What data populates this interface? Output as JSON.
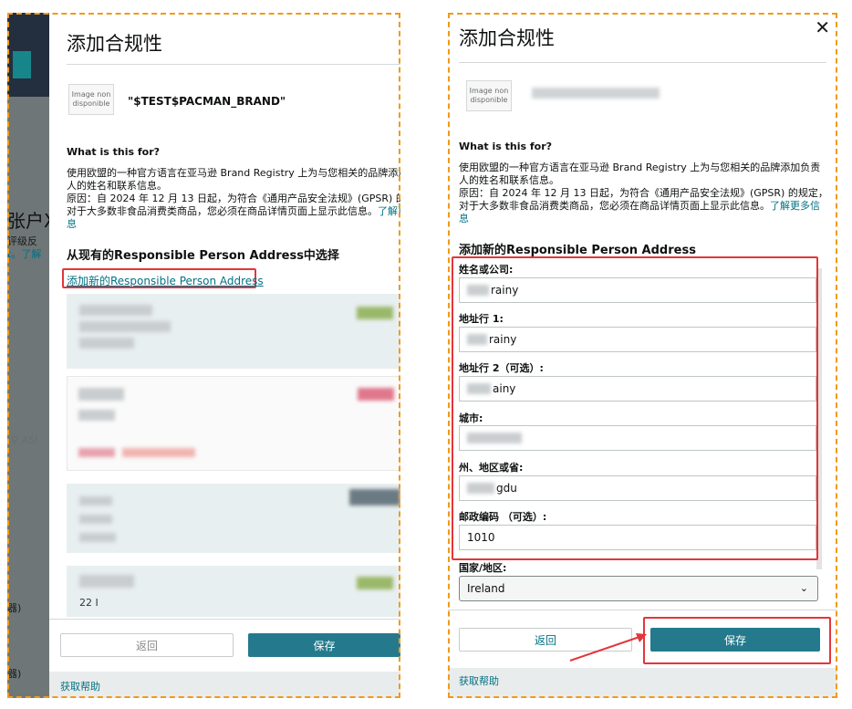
{
  "left": {
    "background": {
      "partial_heading": "张户X",
      "partial_sub_1": "评级反",
      "partial_sub_2": "t。了解",
      "search_fragment": "ASI",
      "fragment_1": "器)",
      "fragment_2": "器)"
    },
    "dialog": {
      "title": "添加合规性",
      "image_placeholder": "Image non disponible",
      "brand_name": "\"$TEST$PACMAN_BRAND\"",
      "what_heading": "What is this for?",
      "desc_line_1": "使用欧盟的一种官方语言在亚马逊 Brand Registry 上为与您相关的品牌添加[",
      "desc_line_2": "人的姓名和联系信息。",
      "desc_line_3": "原因：自 2024 年 12 月 13 日起，为符合《通用产品安全法规》(GPSR) 的[",
      "desc_line_4_text": "对于大多数非食品消费类商品，您必须在商品详情页面上显示此信息。",
      "desc_line_4_link": "了解更",
      "desc_line_5": "息",
      "select_heading": "从现有的Responsible Person Address中选择",
      "add_new_link": "添加新的Responsible Person Address",
      "card_fragment": "22 I",
      "back_label": "返回",
      "save_label": "保存",
      "help_link": "获取帮助"
    }
  },
  "right": {
    "dialog": {
      "title": "添加合规性",
      "close_icon": "✕",
      "image_placeholder": "Image non disponible",
      "what_heading": "What is this for?",
      "desc_line_1": "使用欧盟的一种官方语言在亚马逊 Brand Registry 上为与您相关的品牌添加负责",
      "desc_line_2": "人的姓名和联系信息。",
      "desc_line_3": "原因：自 2024 年 12 月 13 日起，为符合《通用产品安全法规》(GPSR) 的规定，",
      "desc_line_4_text": "对于大多数非食品消费类商品，您必须在商品详情页面上显示此信息。",
      "desc_line_4_link": "了解更多信",
      "desc_line_5_link": "息",
      "add_heading": "添加新的Responsible Person Address",
      "fields": [
        {
          "label": "姓名或公司:",
          "value": "rainy"
        },
        {
          "label": "地址行 1:",
          "value": "rainy"
        },
        {
          "label": "地址行 2（可选）:",
          "value": "ainy"
        },
        {
          "label": "城市:",
          "value": ""
        },
        {
          "label": "州、地区或省:",
          "value": "gdu"
        },
        {
          "label": "邮政编码 （可选）:",
          "value": "1010"
        }
      ],
      "country_label": "国家/地区:",
      "country_value": "Ireland",
      "back_label": "返回",
      "save_label": "保存",
      "help_link": "获取帮助"
    }
  },
  "colors": {
    "accent_teal": "#247a8c",
    "link": "#007185",
    "annotation_red": "#e3363b",
    "dashed_border": "#f09a1a"
  }
}
